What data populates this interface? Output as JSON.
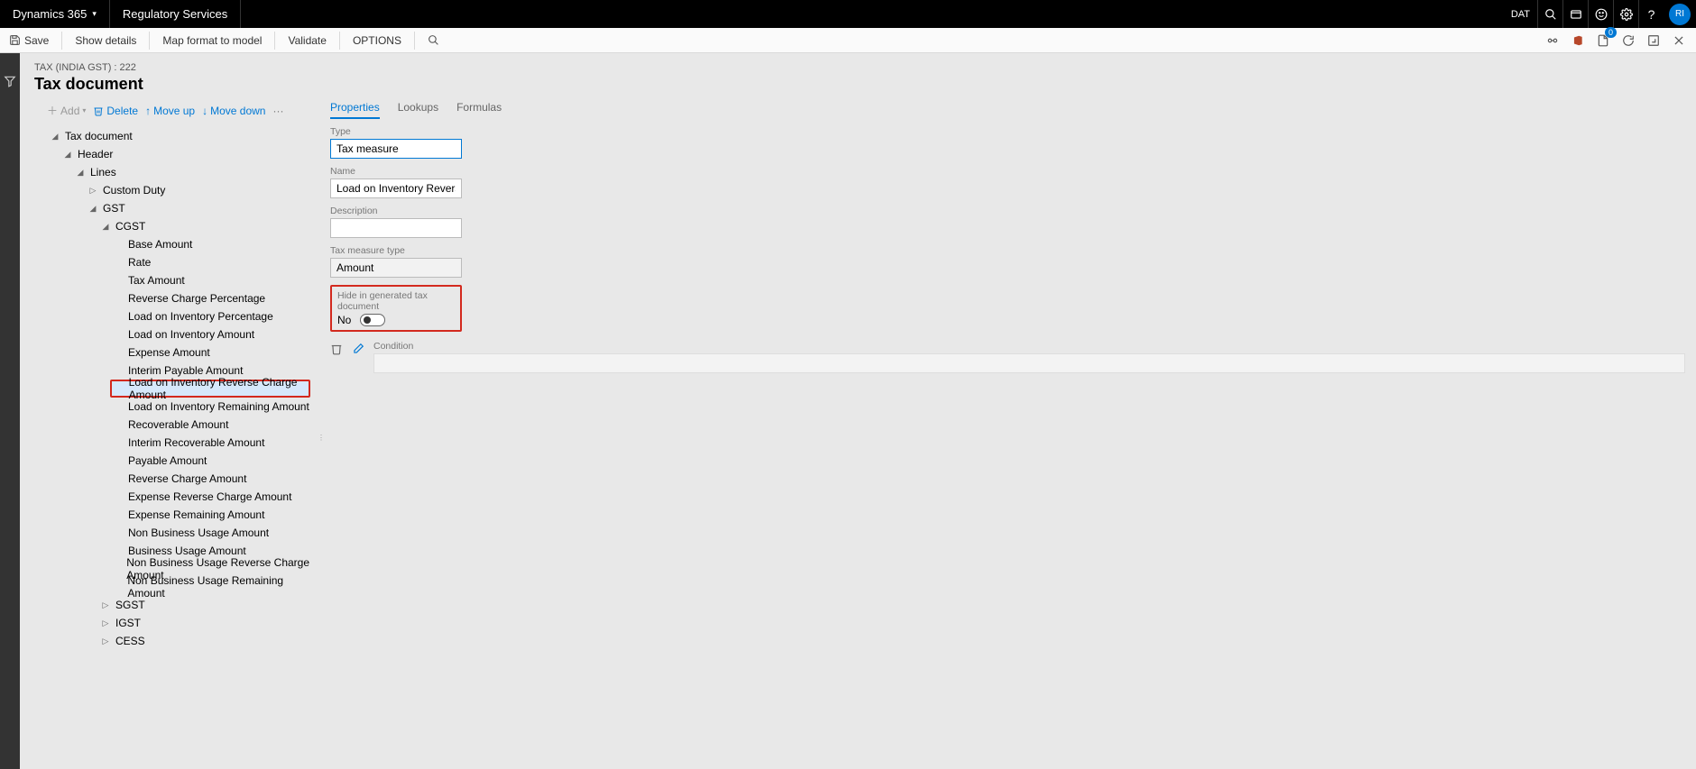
{
  "topbar": {
    "brand": "Dynamics 365",
    "module": "Regulatory Services",
    "dat_label": "DAT",
    "avatar": "RI"
  },
  "cmdbar": {
    "save": "Save",
    "show_details": "Show details",
    "map_format": "Map format to model",
    "validate": "Validate",
    "options": "OPTIONS",
    "notif_count": "0"
  },
  "page": {
    "breadcrumb": "TAX (INDIA GST) : 222",
    "title": "Tax document"
  },
  "tree_actions": {
    "add": "Add",
    "delete": "Delete",
    "move_up": "Move up",
    "move_down": "Move down"
  },
  "tree": {
    "root": "Tax document",
    "header": "Header",
    "lines": "Lines",
    "custom_duty": "Custom Duty",
    "gst": "GST",
    "cgst": "CGST",
    "sgst": "SGST",
    "igst": "IGST",
    "cess": "CESS",
    "cgst_children": [
      "Base Amount",
      "Rate",
      "Tax Amount",
      "Reverse Charge Percentage",
      "Load on Inventory Percentage",
      "Load on Inventory Amount",
      "Expense Amount",
      "Interim Payable Amount",
      "Load on Inventory Reverse Charge Amount",
      "Load on Inventory Remaining Amount",
      "Recoverable Amount",
      "Interim Recoverable Amount",
      "Payable Amount",
      "Reverse Charge Amount",
      "Expense Reverse Charge Amount",
      "Expense Remaining Amount",
      "Non Business Usage Amount",
      "Business Usage Amount",
      "Non Business Usage Reverse Charge Amount",
      "Non Business Usage Remaining Amount"
    ],
    "selected_index": 8
  },
  "tabs": {
    "properties": "Properties",
    "lookups": "Lookups",
    "formulas": "Formulas"
  },
  "props": {
    "type_label": "Type",
    "type_value": "Tax measure",
    "name_label": "Name",
    "name_value": "Load on Inventory Reverse Char...",
    "desc_label": "Description",
    "desc_value": "",
    "measure_type_label": "Tax measure type",
    "measure_type_value": "Amount",
    "hide_label": "Hide in generated tax document",
    "hide_value": "No",
    "condition_label": "Condition"
  }
}
